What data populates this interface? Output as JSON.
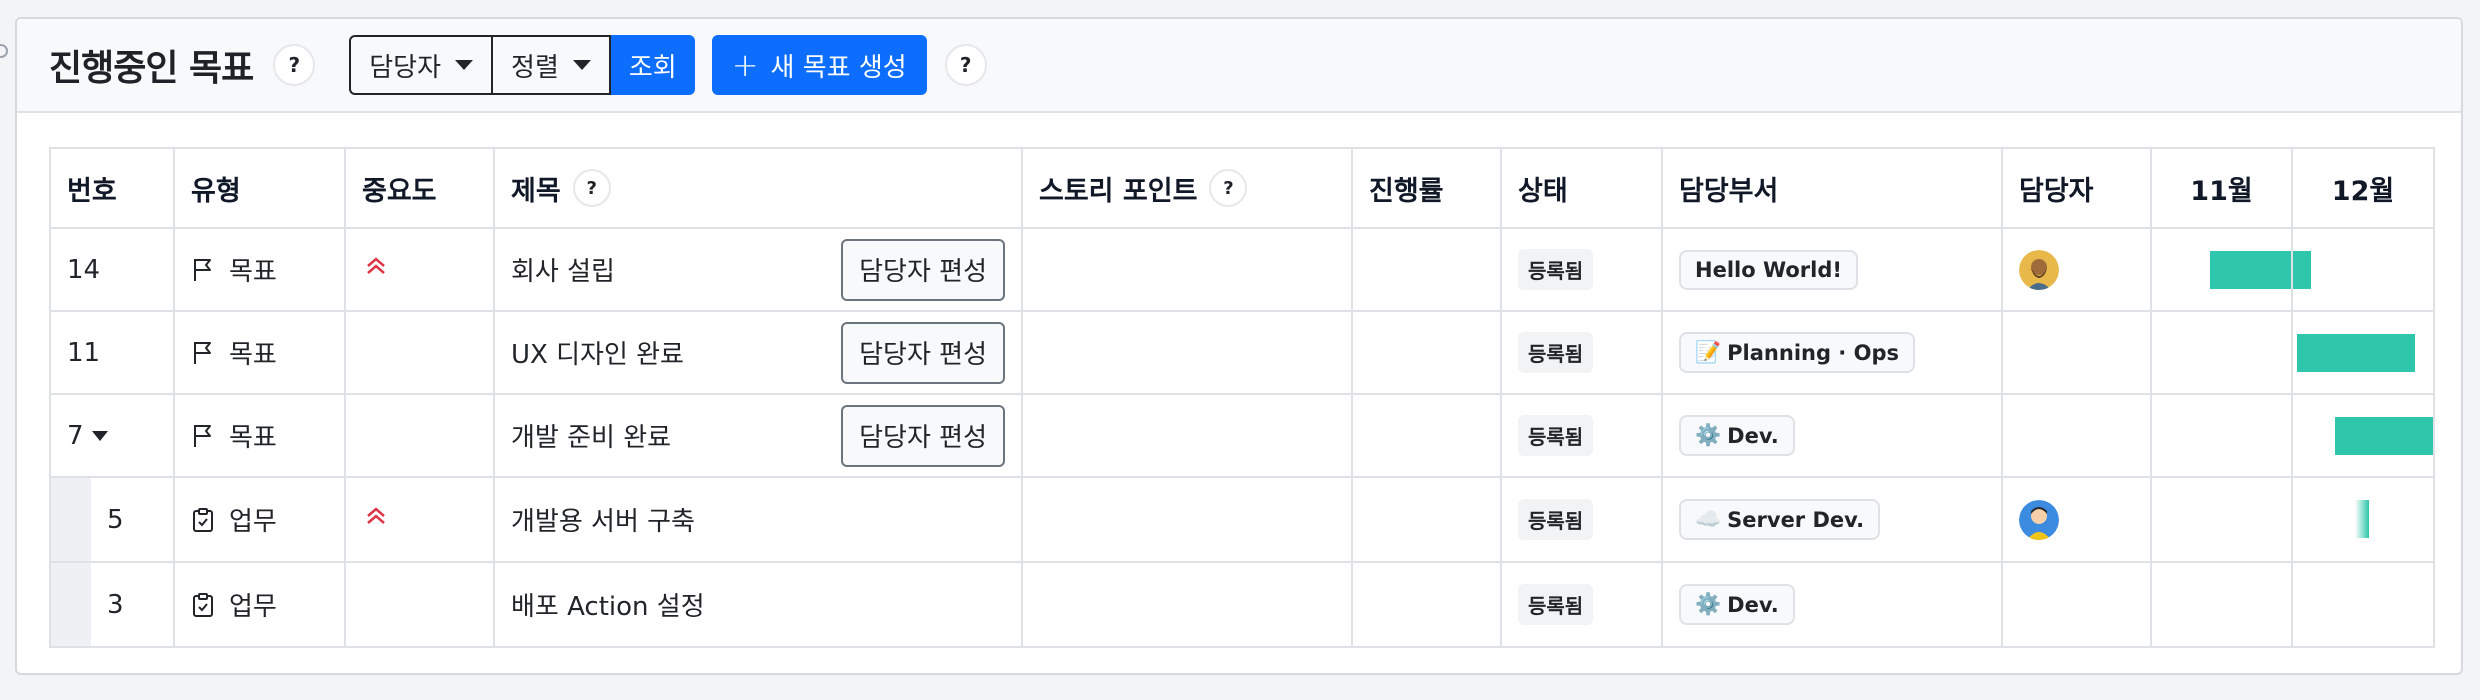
{
  "header": {
    "title": "진행중인 목표",
    "help_1": "?",
    "assignee_dropdown": "담당자",
    "sort_dropdown": "정렬",
    "query_button": "조회",
    "new_goal_button": "새 목표 생성",
    "help_2": "?"
  },
  "table": {
    "columns": {
      "number": "번호",
      "type": "유형",
      "priority": "중요도",
      "title": "제목",
      "title_help": "?",
      "story_points": "스토리 포인트",
      "story_points_help": "?",
      "progress": "진행률",
      "status": "상태",
      "department": "담당부서",
      "assignee": "담당자",
      "month_1": "11월",
      "month_2": "12월"
    },
    "rows": [
      {
        "number": "14",
        "type": "목표",
        "type_icon": "flag-icon",
        "priority": "high",
        "title": "회사 설립",
        "edit_button": "담당자 편성",
        "story_points": "",
        "progress": "",
        "status": "등록됨",
        "department": "Hello World!",
        "department_icon": "",
        "assignee_avatar": "avatar-bearded-man",
        "child": false,
        "expandable": false
      },
      {
        "number": "11",
        "type": "목표",
        "type_icon": "flag-icon",
        "priority": "",
        "title": "UX 디자인 완료",
        "edit_button": "담당자 편성",
        "story_points": "",
        "progress": "",
        "status": "등록됨",
        "department": "Planning · Ops",
        "department_icon": "📝",
        "assignee_avatar": "",
        "child": false,
        "expandable": false
      },
      {
        "number": "7",
        "type": "목표",
        "type_icon": "flag-icon",
        "priority": "",
        "title": "개발 준비 완료",
        "edit_button": "담당자 편성",
        "story_points": "",
        "progress": "",
        "status": "등록됨",
        "department": "Dev.",
        "department_icon": "⚙️",
        "assignee_avatar": "",
        "child": false,
        "expandable": true
      },
      {
        "number": "5",
        "type": "업무",
        "type_icon": "clipboard-icon",
        "priority": "high",
        "title": "개발용 서버 구축",
        "edit_button": "",
        "story_points": "",
        "progress": "",
        "status": "등록됨",
        "department": "Server Dev.",
        "department_icon": "☁️",
        "assignee_avatar": "avatar-blue-person",
        "child": true,
        "expandable": false
      },
      {
        "number": "3",
        "type": "업무",
        "type_icon": "clipboard-icon",
        "priority": "",
        "title": "배포 Action 설정",
        "edit_button": "",
        "story_points": "",
        "progress": "",
        "status": "등록됨",
        "department": "Dev.",
        "department_icon": "⚙️",
        "assignee_avatar": "",
        "child": true,
        "expandable": false
      }
    ]
  },
  "colors": {
    "primary": "#0d6efd",
    "gantt_bar": "#2ec7ab",
    "priority_high": "#dc3545",
    "border": "#dee2e6"
  }
}
